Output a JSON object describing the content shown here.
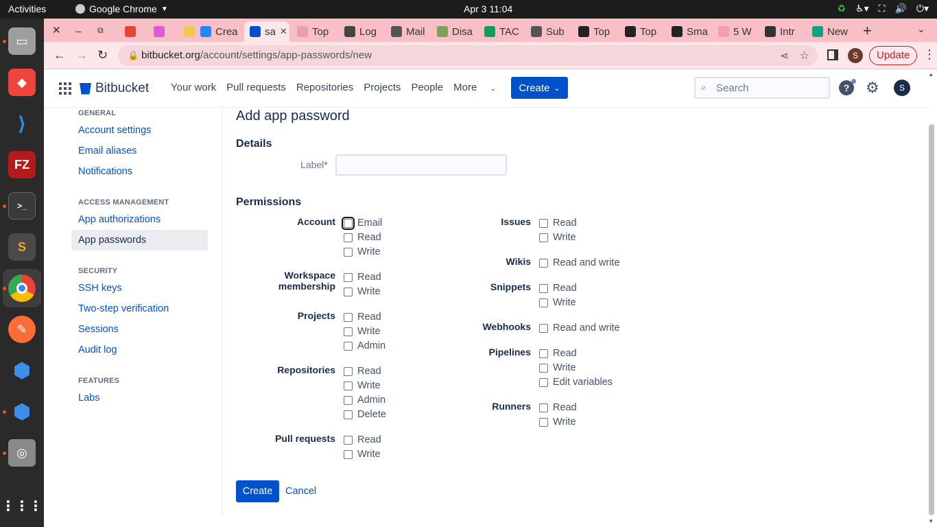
{
  "system": {
    "activities": "Activities",
    "app_name": "Google Chrome",
    "clock": "Apr 3  11:04"
  },
  "browser": {
    "tabs": [
      {
        "label": "",
        "color": "#ea4335"
      },
      {
        "label": "",
        "color": "#e05ad8"
      },
      {
        "label": "",
        "color": "#f2c94c"
      },
      {
        "label": "Crea",
        "color": "#2684ff"
      },
      {
        "label": "sa",
        "color": "#0052cc"
      },
      {
        "label": "Top",
        "color": "#e8a0b0"
      },
      {
        "label": "Log",
        "color": "#444444"
      },
      {
        "label": "Mail",
        "color": "#555555"
      },
      {
        "label": "Disa",
        "color": "#7aa35a"
      },
      {
        "label": "TAC",
        "color": "#0f9d58"
      },
      {
        "label": "Sub",
        "color": "#555555"
      },
      {
        "label": "Top",
        "color": "#222222"
      },
      {
        "label": "Top",
        "color": "#222222"
      },
      {
        "label": "Sma",
        "color": "#222222"
      },
      {
        "label": "5 W",
        "color": "#f0a0b0"
      },
      {
        "label": "Intr",
        "color": "#333333"
      },
      {
        "label": "New",
        "color": "#10a37f"
      }
    ],
    "url_domain": "bitbucket.org",
    "url_path": "/account/settings/app-passwords/new",
    "profile_initial": "S",
    "update_label": "Update"
  },
  "dock": {
    "items": [
      "Files",
      "AnyDesk",
      "VS Code",
      "FileZilla",
      "Terminal",
      "Sublime Text",
      "Chrome",
      "Postman",
      "Toolbox",
      "Toolbox 2",
      "Disks"
    ]
  },
  "header": {
    "logo_text": "Bitbucket",
    "nav": [
      "Your work",
      "Pull requests",
      "Repositories",
      "Projects",
      "People",
      "More"
    ],
    "create_label": "Create",
    "search_placeholder": "Search",
    "avatar_initial": "S"
  },
  "sidebar": {
    "general_title": "GENERAL",
    "account_settings": "Account settings",
    "email_aliases": "Email aliases",
    "notifications": "Notifications",
    "access_title": "ACCESS MANAGEMENT",
    "app_authorizations": "App authorizations",
    "app_passwords": "App passwords",
    "security_title": "SECURITY",
    "ssh_keys": "SSH keys",
    "two_step": "Two-step verification",
    "sessions": "Sessions",
    "audit_log": "Audit log",
    "features_title": "FEATURES",
    "labs": "Labs"
  },
  "form": {
    "title": "Add app password",
    "details_heading": "Details",
    "label_field": "Label",
    "label_value": "",
    "permissions_heading": "Permissions",
    "groups": {
      "account": {
        "label": "Account",
        "options": [
          "Email",
          "Read",
          "Write"
        ]
      },
      "workspace": {
        "label_1": "Workspace",
        "label_2": "membership",
        "options": [
          "Read",
          "Write"
        ]
      },
      "projects": {
        "label": "Projects",
        "options": [
          "Read",
          "Write",
          "Admin"
        ]
      },
      "repositories": {
        "label": "Repositories",
        "options": [
          "Read",
          "Write",
          "Admin",
          "Delete"
        ]
      },
      "pull_requests": {
        "label": "Pull requests",
        "options": [
          "Read",
          "Write"
        ]
      },
      "issues": {
        "label": "Issues",
        "options": [
          "Read",
          "Write"
        ]
      },
      "wikis": {
        "label": "Wikis",
        "options": [
          "Read and write"
        ]
      },
      "snippets": {
        "label": "Snippets",
        "options": [
          "Read",
          "Write"
        ]
      },
      "webhooks": {
        "label": "Webhooks",
        "options": [
          "Read and write"
        ]
      },
      "pipelines": {
        "label": "Pipelines",
        "options": [
          "Read",
          "Write",
          "Edit variables"
        ]
      },
      "runners": {
        "label": "Runners",
        "options": [
          "Read",
          "Write"
        ]
      }
    },
    "create_label": "Create",
    "cancel_label": "Cancel"
  }
}
